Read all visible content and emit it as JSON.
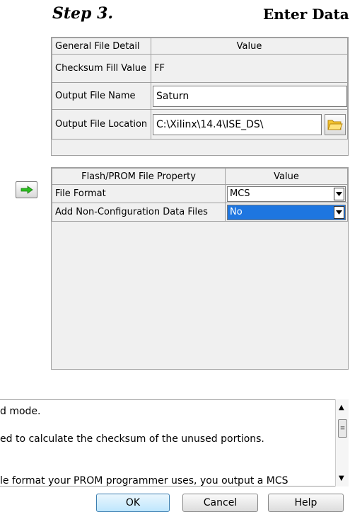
{
  "header": {
    "step": "Step 3.",
    "title": "Enter Data"
  },
  "general": {
    "col_name": "General File Detail",
    "col_value": "Value",
    "rows": [
      {
        "label": "Checksum Fill Value",
        "value": "FF"
      },
      {
        "label": "Output File Name",
        "value": "Saturn"
      },
      {
        "label": "Output File Location",
        "value": "C:\\Xilinx\\14.4\\ISE_DS\\"
      }
    ]
  },
  "flash": {
    "col_name": "Flash/PROM File Property",
    "col_value": "Value",
    "rows": [
      {
        "label": "File Format",
        "value": "MCS"
      },
      {
        "label": "Add Non-Configuration Data Files",
        "value": "No"
      }
    ]
  },
  "description": {
    "lines": [
      "d mode.",
      "ed to calculate the checksum of the unused portions.",
      "le format your PROM programmer uses, you output a MCS"
    ]
  },
  "buttons": {
    "ok": "OK",
    "cancel": "Cancel",
    "help": "Help"
  },
  "colors": {
    "selection": "#1e76e0",
    "arrow_green": "#2bbf1f",
    "folder": "#f4c430"
  }
}
